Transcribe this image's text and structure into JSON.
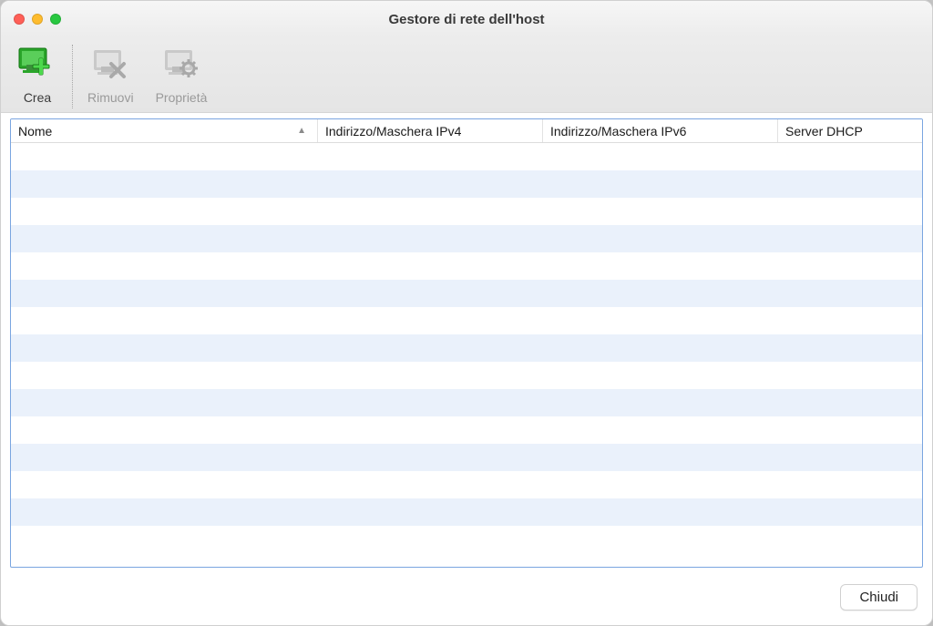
{
  "window": {
    "title": "Gestore di rete dell'host"
  },
  "toolbar": {
    "create_label": "Crea",
    "remove_label": "Rimuovi",
    "properties_label": "Proprietà"
  },
  "table": {
    "columns": {
      "name": "Nome",
      "ipv4": "Indirizzo/Maschera IPv4",
      "ipv6": "Indirizzo/Maschera IPv6",
      "dhcp": "Server DHCP"
    },
    "sort_column": "name",
    "sort_direction": "asc",
    "rows": []
  },
  "footer": {
    "close_label": "Chiudi"
  }
}
